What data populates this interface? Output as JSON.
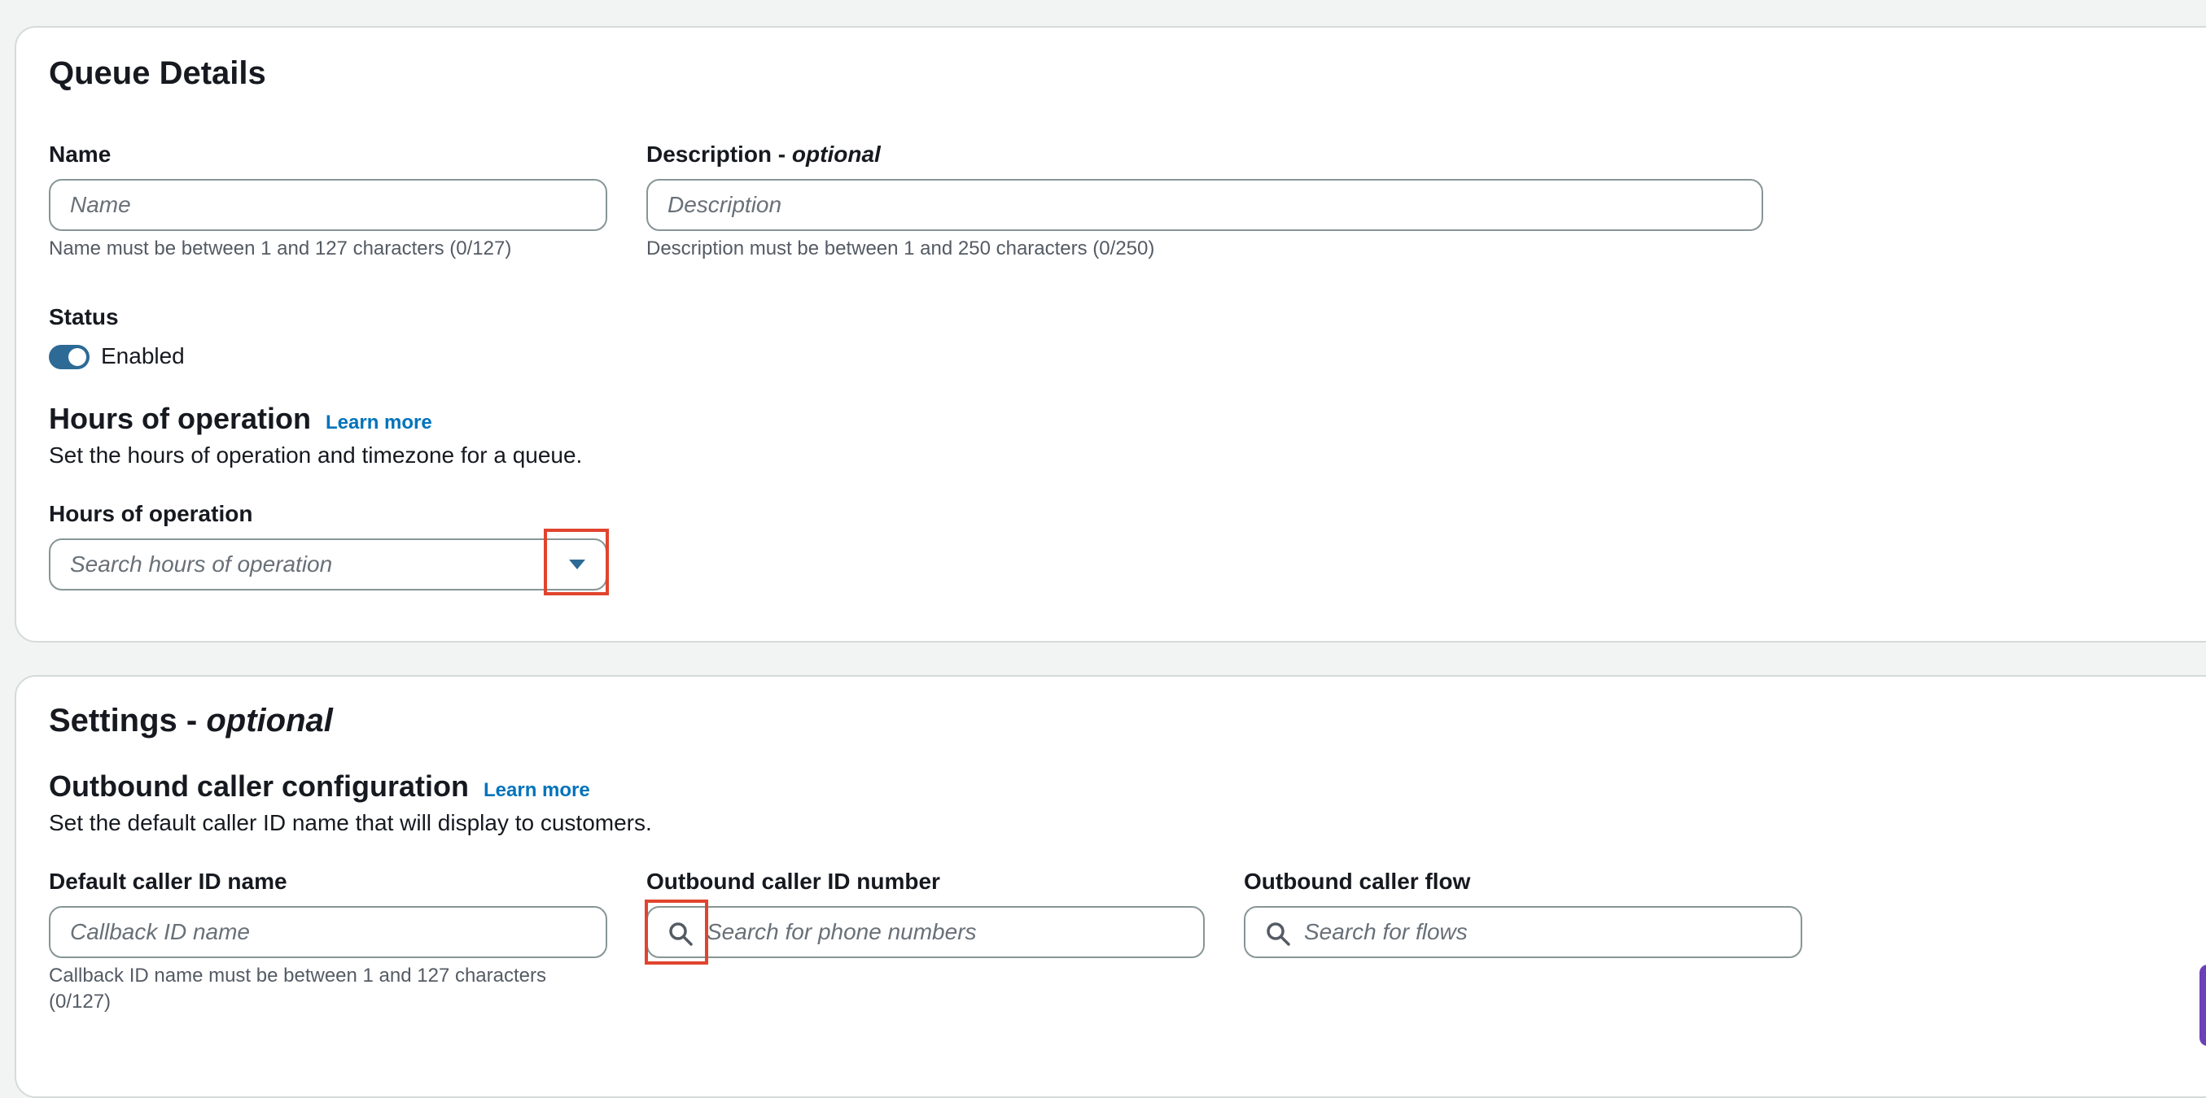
{
  "queue_details": {
    "title": "Queue Details",
    "name": {
      "label": "Name",
      "placeholder": "Name",
      "value": "",
      "hint": "Name must be between 1 and 127 characters (0/127)"
    },
    "description": {
      "label": "Description - ",
      "label_optional": "optional",
      "placeholder": "Description",
      "value": "",
      "hint": "Description must be between 1 and 250 characters (0/250)"
    },
    "status": {
      "label": "Status",
      "toggle_label": "Enabled",
      "enabled": true
    },
    "hours_section": {
      "title": "Hours of operation",
      "learn_more": "Learn more",
      "description": "Set the hours of operation and timezone for a queue.",
      "field_label": "Hours of operation",
      "placeholder": "Search hours of operation",
      "value": ""
    }
  },
  "settings": {
    "title": "Settings - ",
    "title_optional": "optional",
    "outbound_section": {
      "title": "Outbound caller configuration",
      "learn_more": "Learn more",
      "description": "Set the default caller ID name that will display to customers."
    },
    "default_caller_id_name": {
      "label": "Default caller ID name",
      "placeholder": "Callback ID name",
      "value": "",
      "hint_line1": "Callback ID name must be between 1 and 127 characters",
      "hint_line2": "(0/127)"
    },
    "outbound_caller_id_number": {
      "label": "Outbound caller ID number",
      "placeholder": "Search for phone numbers",
      "value": ""
    },
    "outbound_caller_flow": {
      "label": "Outbound caller flow",
      "placeholder": "Search for flows",
      "value": ""
    }
  },
  "icons": {
    "dropdown": "caret-down-icon",
    "search": "search-icon"
  },
  "colors": {
    "link": "#0073bb",
    "toggle_on": "#2d6a95",
    "highlight": "#e0442e",
    "border": "#879596"
  }
}
